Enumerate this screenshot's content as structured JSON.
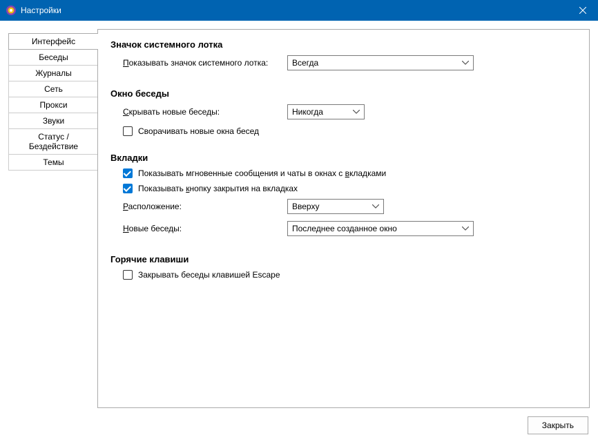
{
  "window": {
    "title": "Настройки"
  },
  "tabs": [
    "Интерфейс",
    "Беседы",
    "Журналы",
    "Сеть",
    "Прокси",
    "Звуки",
    "Статус / Бездействие",
    "Темы"
  ],
  "sections": {
    "tray": {
      "title": "Значок системного лотка",
      "show_label_pre": "П",
      "show_label_post": "оказывать значок системного лотка:",
      "show_value": "Всегда"
    },
    "convwin": {
      "title": "Окно беседы",
      "hide_label_pre": "С",
      "hide_label_post": "крывать новые беседы:",
      "hide_value": "Никогда",
      "minimize_label": "Сворачивать новые окна бесед",
      "minimize_checked": false
    },
    "tabs_section": {
      "title": "Вкладки",
      "show_im_label_pre": "Показывать мгновенные сообщения и чаты в окнах с ",
      "show_im_key": "в",
      "show_im_label_post": "кладками",
      "show_im_checked": true,
      "show_close_label_pre": "Показывать ",
      "show_close_key": "к",
      "show_close_label_post": "нопку закрытия на вкладках",
      "show_close_checked": true,
      "placement_label_key": "Р",
      "placement_label_post": "асположение:",
      "placement_value": "Вверху",
      "newconv_label_key": "Н",
      "newconv_label_post": "овые беседы:",
      "newconv_value": "Последнее созданное окно"
    },
    "hotkeys": {
      "title": "Горячие клавиши",
      "escape_label": "Закрывать беседы клавишей Escape",
      "escape_checked": false
    }
  },
  "footer": {
    "close_label": "Закрыть"
  }
}
